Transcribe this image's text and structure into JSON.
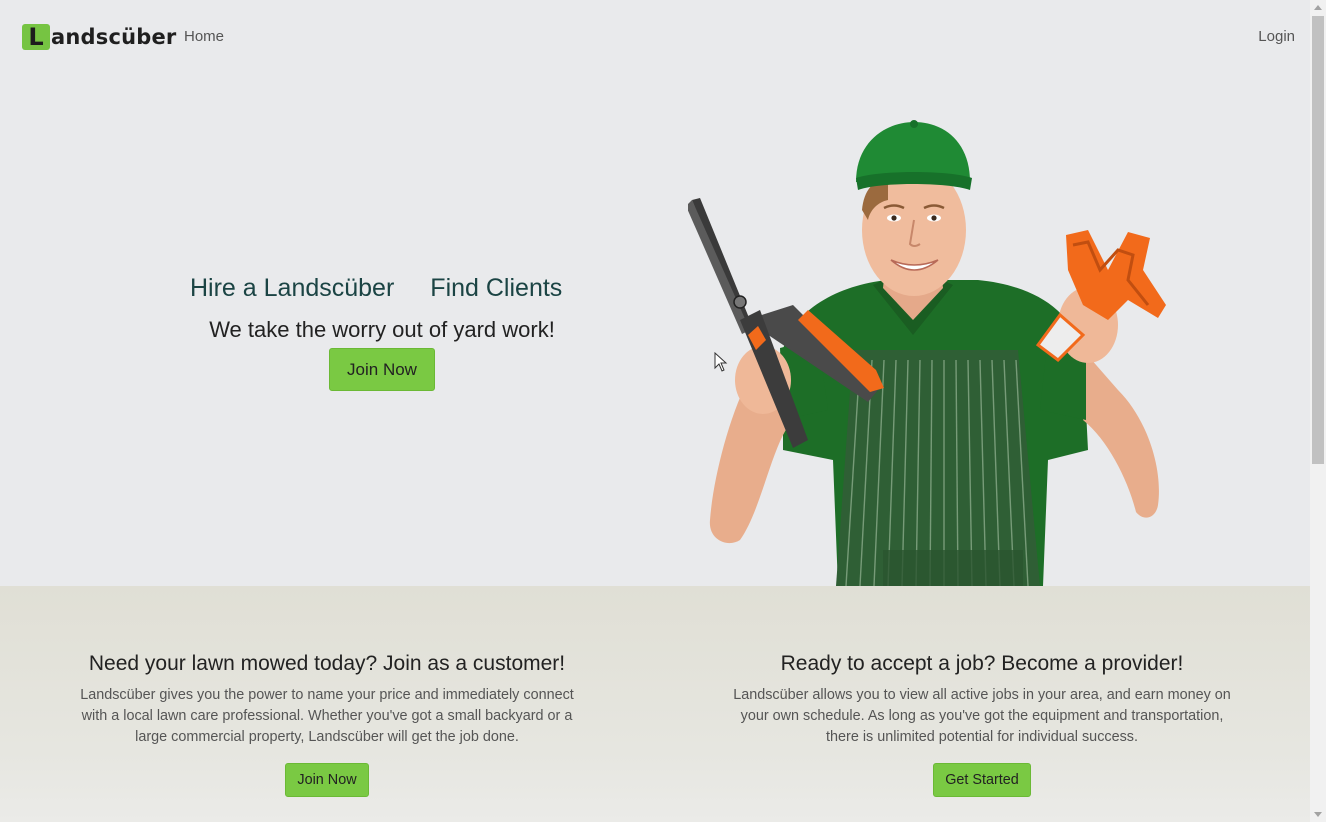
{
  "navbar": {
    "brand_letter": "L",
    "brand_rest": "andscüber",
    "home_label": "Home",
    "login_label": "Login"
  },
  "hero": {
    "hire_label": "Hire a Landscüber",
    "find_label": "Find Clients",
    "tagline": "We take the worry out of yard work!",
    "join_label": "Join Now"
  },
  "features": {
    "customer": {
      "title": "Need your lawn mowed today? Join as a customer!",
      "description": "Landscüber gives you the power to name your price and immediately connect with a local lawn care professional. Whether you've got a small backyard or a large commercial property, Landscüber will get the job done.",
      "button_label": "Join Now"
    },
    "provider": {
      "title": "Ready to accept a job? Become a provider!",
      "description": "Landscüber allows you to view all active jobs in your area, and earn money on your own schedule. As long as you've got the equipment and transportation, there is unlimited potential for individual success.",
      "button_label": "Get Started"
    }
  },
  "colors": {
    "accent": "#7ac943",
    "brand_green": "#76c442",
    "hero_background": "#e9eaec",
    "features_background": "#e0dfd5",
    "link_heading": "#1b4444",
    "uniform_green": "#1f7a2a",
    "tool_orange": "#f26a1b"
  },
  "icons": {
    "cursor": "mouse-pointer-icon",
    "hero_image": "gardener-with-shears-and-gloves"
  }
}
